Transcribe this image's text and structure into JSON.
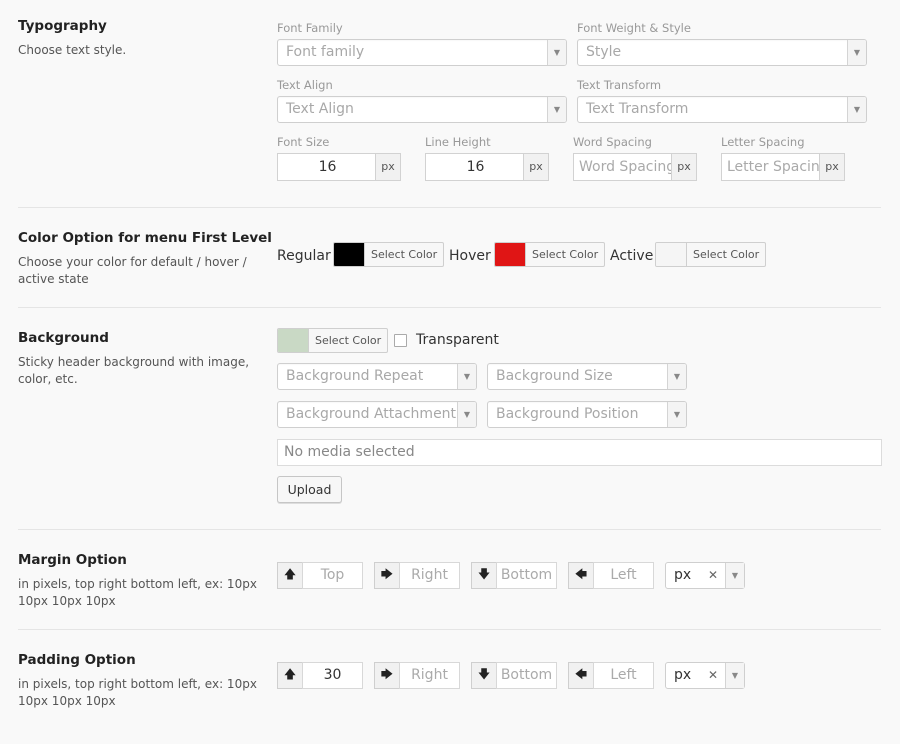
{
  "typography": {
    "title": "Typography",
    "desc": "Choose text style.",
    "font_family_label": "Font Family",
    "font_family_placeholder": "Font family",
    "font_weight_label": "Font Weight & Style",
    "font_weight_placeholder": "Style",
    "text_align_label": "Text Align",
    "text_align_placeholder": "Text Align",
    "text_transform_label": "Text Transform",
    "text_transform_placeholder": "Text Transform",
    "font_size_label": "Font Size",
    "font_size_value": "16",
    "line_height_label": "Line Height",
    "line_height_value": "16",
    "word_spacing_label": "Word Spacing",
    "word_spacing_placeholder": "Word Spacing",
    "letter_spacing_label": "Letter Spacing",
    "letter_spacing_placeholder": "Letter Spacing",
    "unit": "px"
  },
  "color_option": {
    "title": "Color Option for menu First Level",
    "desc": "Choose your color for default / hover / active state",
    "regular_label": "Regular",
    "hover_label": "Hover",
    "active_label": "Active",
    "select_color": "Select Color",
    "regular_color": "#000000",
    "hover_color": "#e01515",
    "active_color": "#f5f5f5"
  },
  "background": {
    "title": "Background",
    "desc": "Sticky header background with image, color, etc.",
    "select_color": "Select Color",
    "color": "#c9d9c5",
    "transparent_label": "Transparent",
    "transparent_checked": false,
    "repeat_placeholder": "Background Repeat",
    "size_placeholder": "Background Size",
    "attachment_placeholder": "Background Attachment",
    "position_placeholder": "Background Position",
    "media_text": "No media selected",
    "upload_label": "Upload"
  },
  "margin": {
    "title": "Margin Option",
    "desc": "in pixels, top right bottom left, ex: 10px 10px 10px 10px",
    "top": "Top",
    "right": "Right",
    "bottom": "Bottom",
    "left": "Left",
    "unit": "px"
  },
  "padding": {
    "title": "Padding Option",
    "desc": "in pixels, top right bottom left, ex: 10px 10px 10px 10px",
    "top": "30",
    "right": "Right",
    "bottom": "Bottom",
    "left": "Left",
    "unit": "px"
  },
  "icons": {
    "up": "arrow-up-icon",
    "right": "arrow-right-icon",
    "down": "arrow-down-icon",
    "left": "arrow-left-icon"
  }
}
